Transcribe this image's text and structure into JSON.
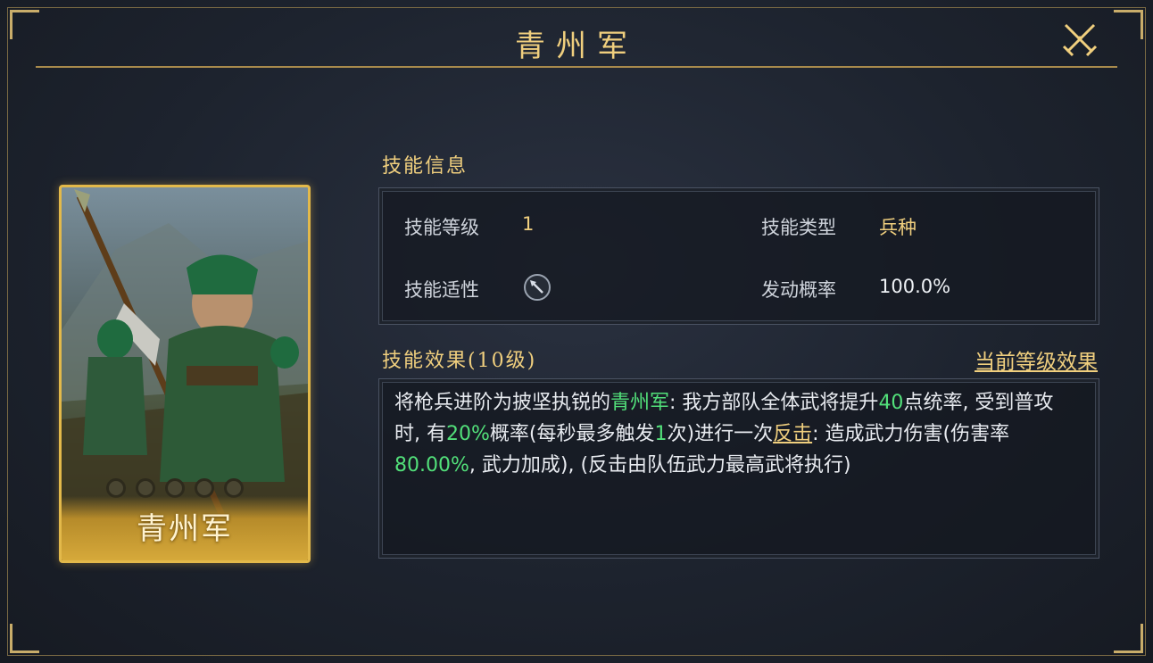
{
  "header": {
    "title": "青州军"
  },
  "card": {
    "name": "青州军",
    "star_count": 5
  },
  "skill_info": {
    "heading": "技能信息",
    "level_label": "技能等级",
    "level_value": "1",
    "type_label": "技能类型",
    "type_value": "兵种",
    "aptitude_label": "技能适性",
    "aptitude_icon": "spear-icon",
    "trigger_label": "发动概率",
    "trigger_value": "100.0%"
  },
  "skill_effect": {
    "heading": "技能效果(10级)",
    "current_level_link": "当前等级效果",
    "text_segments": [
      {
        "text": "将枪兵进阶为披坚执锐的",
        "style": "normal"
      },
      {
        "text": "青州军",
        "style": "green"
      },
      {
        "text": ": 我方部队全体武将提升",
        "style": "normal"
      },
      {
        "text": "40",
        "style": "green"
      },
      {
        "text": "点统率, 受到普攻时, 有",
        "style": "normal"
      },
      {
        "text": "20%",
        "style": "green"
      },
      {
        "text": "概率(每秒最多触发",
        "style": "normal"
      },
      {
        "text": "1",
        "style": "green"
      },
      {
        "text": "次)进行一次",
        "style": "normal"
      },
      {
        "text": "反击",
        "style": "gold-link"
      },
      {
        "text": ": 造成武力伤害(伤害率",
        "style": "normal"
      },
      {
        "text": "80.00%",
        "style": "green"
      },
      {
        "text": ", 武力加成), (反击由队伍武力最高武将执行)",
        "style": "normal"
      }
    ]
  },
  "colors": {
    "accent_gold": "#f0cf7e",
    "highlight_green": "#52e07a",
    "card_border": "#e3b94a"
  }
}
